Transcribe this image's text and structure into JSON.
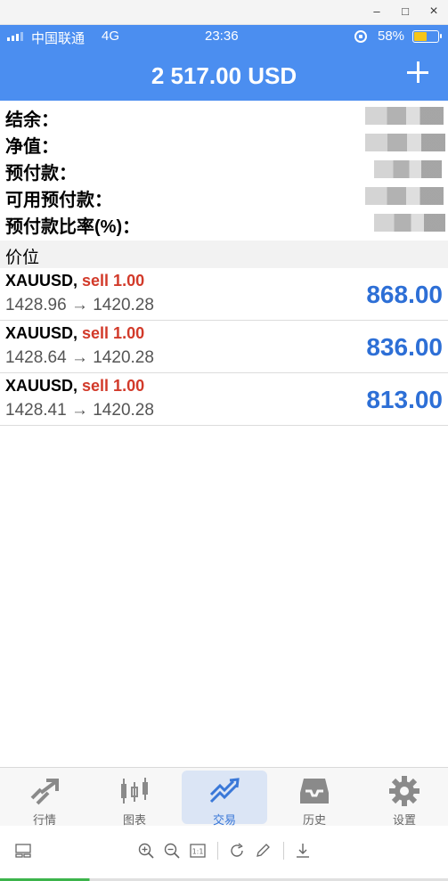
{
  "window": {
    "minimize": "–",
    "maximize": "□",
    "close": "×"
  },
  "status_bar": {
    "carrier": "中国联通",
    "network": "4G",
    "time": "23:36",
    "battery_percent": "58%",
    "battery_level": 0.58,
    "battery_color": "#f5c518"
  },
  "header": {
    "title": "2 517.00 USD",
    "add_icon": "plus-icon",
    "background_color": "#4b8ef0"
  },
  "summary": {
    "rows": [
      {
        "label": "结余："
      },
      {
        "label": "净值："
      },
      {
        "label": "预付款："
      },
      {
        "label": "可用预付款："
      },
      {
        "label": "预付款比率(%)："
      }
    ]
  },
  "section_title": "价位",
  "positions": [
    {
      "symbol": "XAUUSD,",
      "side": "sell 1.00",
      "prices": "1428.96 → 1420.28",
      "profit": "868.00"
    },
    {
      "symbol": "XAUUSD,",
      "side": "sell 1.00",
      "prices": "1428.64 → 1420.28",
      "profit": "836.00"
    },
    {
      "symbol": "XAUUSD,",
      "side": "sell 1.00",
      "prices": "1428.41 → 1420.28",
      "profit": "813.00"
    }
  ],
  "colors": {
    "sell": "#d23a2a",
    "profit": "#2d6fd6",
    "active_tab": "#3a78d8"
  },
  "tabs": [
    {
      "label": "行情",
      "icon": "quotes-icon"
    },
    {
      "label": "图表",
      "icon": "chart-icon"
    },
    {
      "label": "交易",
      "icon": "trade-icon",
      "active": true
    },
    {
      "label": "历史",
      "icon": "history-icon"
    },
    {
      "label": "设置",
      "icon": "settings-icon"
    }
  ],
  "toolbar": {
    "icons": [
      "layout-icon",
      "zoom-in-icon",
      "zoom-out-icon",
      "actual-size-icon",
      "rotate-icon",
      "edit-icon",
      "download-icon"
    ],
    "actual_size_label": "1:1"
  }
}
